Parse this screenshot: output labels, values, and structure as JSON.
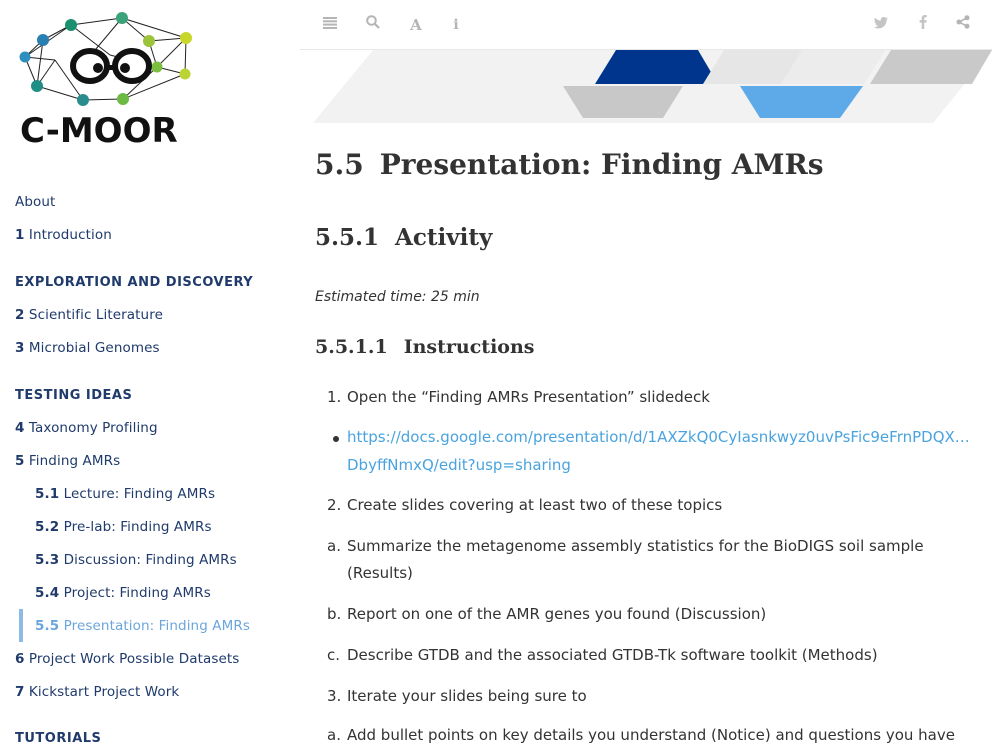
{
  "logo": {
    "text": "C-MOOR"
  },
  "toolbar": {
    "icons": [
      "menu-icon",
      "search-icon",
      "font-icon",
      "info-icon",
      "twitter-icon",
      "facebook-icon",
      "share-icon"
    ]
  },
  "sidebar": {
    "items": [
      {
        "num": "",
        "label": "About"
      },
      {
        "num": "1",
        "label": "Introduction"
      }
    ],
    "part1": "EXPLORATION AND DISCOVERY",
    "part1_items": [
      {
        "num": "2",
        "label": "Scientific Literature"
      },
      {
        "num": "3",
        "label": "Microbial Genomes"
      }
    ],
    "part2": "TESTING IDEAS",
    "part2_items": [
      {
        "num": "4",
        "label": "Taxonomy Profiling"
      },
      {
        "num": "5",
        "label": "Finding AMRs"
      }
    ],
    "sub_items": [
      {
        "num": "5.1",
        "label": "Lecture: Finding AMRs"
      },
      {
        "num": "5.2",
        "label": "Pre-lab: Finding AMRs"
      },
      {
        "num": "5.3",
        "label": "Discussion: Finding AMRs"
      },
      {
        "num": "5.4",
        "label": "Project: Finding AMRs"
      },
      {
        "num": "5.5",
        "label": "Presentation: Finding AMRs"
      }
    ],
    "more_items": [
      {
        "num": "6",
        "label": "Project Work Possible Datasets"
      },
      {
        "num": "7",
        "label": "Kickstart Project Work"
      }
    ],
    "part3": "TUTORIALS"
  },
  "content": {
    "h1_num": "5.5",
    "h1_text": "Presentation: Finding AMRs",
    "h2_num": "5.5.1",
    "h2_text": "Activity",
    "estimated": "Estimated time: 25 min",
    "h3_num": "5.5.1.1",
    "h3_text": "Instructions",
    "list": [
      {
        "marker": "1.",
        "text": "Open the “Finding AMRs Presentation” slidedeck"
      },
      {
        "marker": "•",
        "text1": "https://docs.google.com/presentation/d/1AXZkQ0CyIasnkwyz0uvPsFic9eFrnPDQX…",
        "text2": "DbyffNmxQ/edit?usp=sharing"
      },
      {
        "marker": "2.",
        "text": "Create slides covering at least two of these topics"
      },
      {
        "marker": "a.",
        "text1": "Summarize the metagenome assembly statistics for the BioDIGS soil sample",
        "text2": "(Results)"
      },
      {
        "marker": "b.",
        "text": "Report on one of the AMR genes you found (Discussion)"
      },
      {
        "marker": "c.",
        "text": "Describe GTDB and the associated GTDB-Tk software toolkit (Methods)"
      },
      {
        "marker": "3.",
        "text": "Iterate your slides being sure to"
      },
      {
        "marker": "a.",
        "text": "Add bullet points on key details you understand (Notice) and questions you have"
      }
    ]
  }
}
